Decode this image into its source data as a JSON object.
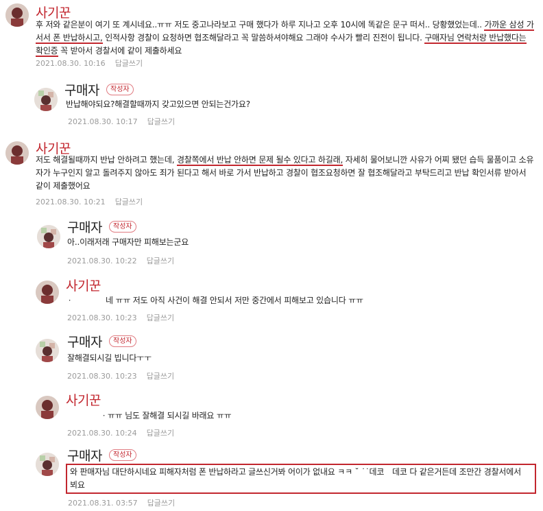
{
  "labels": {
    "author_badge": "작성자",
    "reply": "답글쓰기"
  },
  "comments": [
    {
      "author": "사기꾼",
      "body_html": "후 저와 같은분이 여기 또 계시네요..ㅠㅠ 저도 중고나라보고 구매 했다가 하루 지나고 오후 10시에 똑같은 문구 떠서.. 당황했었는데.. <span class=\"ul\">가까운 삼성 가서서 폰 반납하시고,</span> 인적사항 경찰이 요청하면 협조해달라고 꼭 말씀하셔야해요 그래야 수사가 빨리 진전이 됩니다. <span class=\"ul\">구매자님 연락처랑 반납했다는 확인증</span> 꼭 받아서 경찰서에 같이 제출하세요",
      "time": "2021.08.30. 10:16"
    },
    {
      "author": "구매자",
      "body": "반납해야되요?해결할때까지 갖고있으면 안되는건가요?",
      "time": "2021.08.30. 10:17"
    },
    {
      "author": "사기꾼",
      "body_html": "저도 해결될때까지 반납 안하려고 했는데, <span class=\"ul\">경찰쪽에서 반납 안하면 문제 될수 있다고 하길래,</span> 자세히 물어보니깐 사유가 어찌 됐던 습득 물품이고 소유자가 누구인지 알고 돌려주지 않아도 죄가 된다고 해서 바로 가서 반납하고 경찰이 협조요청하면 잘 협조해달라고 부탁드리고 반납 확인서류 받아서 같이 제출했어요",
      "time": "2021.08.30. 10:21"
    },
    {
      "author": "구매자",
      "body": "아..이래저래 구매자만 피해보는군요",
      "time": "2021.08.30. 10:22"
    },
    {
      "author": "사기꾼",
      "body": "ㆍ　　　　네 ㅠㅠ 저도 아직 사건이 해결 안되서 저만 중간에서 피해보고 있습니다 ㅠㅠ",
      "time": "2021.08.30. 10:23"
    },
    {
      "author": "구매자",
      "body": "잘해결되시길 빕니다ㅜㅜ",
      "time": "2021.08.30. 10:23"
    },
    {
      "author": "사기꾼",
      "body": "ㆍㅠㅠ 님도 잘해결 되시길 바래요 ㅠㅠ",
      "time": "2021.08.30. 10:24"
    },
    {
      "author": "구매자",
      "body": "와 판매자님 대단하시네요 피해자처럼 폰 반납하라고 글쓰신거봐 어이가 없내요 ㅋㅋ ˘ ˙˙데코　데코 다 같은거든데 조만간 경찰서에서 뵈요",
      "time": "2021.08.31. 03:57"
    }
  ]
}
